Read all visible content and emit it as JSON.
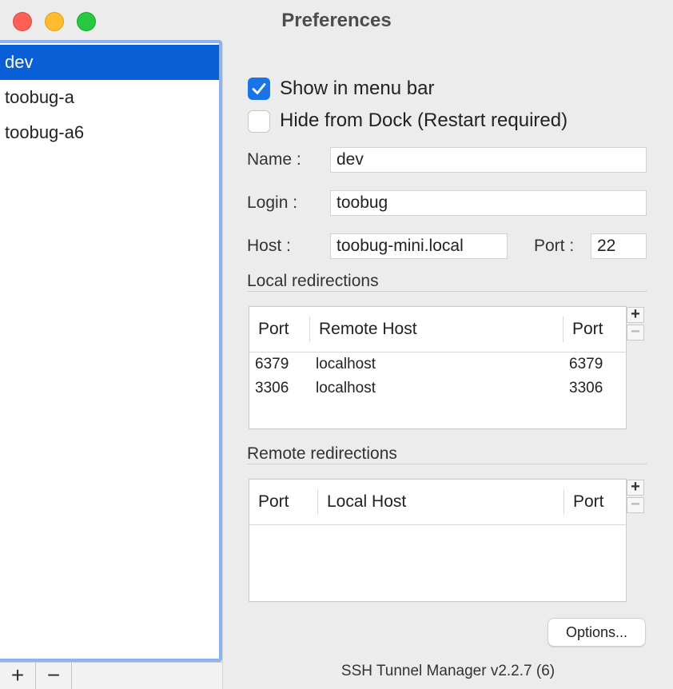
{
  "window": {
    "title": "Preferences"
  },
  "sidebar": {
    "items": [
      {
        "label": "dev",
        "selected": true
      },
      {
        "label": "toobug-a",
        "selected": false
      },
      {
        "label": "toobug-a6",
        "selected": false
      }
    ],
    "add_label": "+",
    "remove_label": "−"
  },
  "options": {
    "show_in_menu_bar": {
      "label": "Show in menu bar",
      "checked": true
    },
    "hide_from_dock": {
      "label": "Hide from Dock (Restart required)",
      "checked": false
    }
  },
  "form": {
    "name_label": "Name :",
    "name_value": "dev",
    "login_label": "Login :",
    "login_value": "toobug",
    "host_label": "Host :",
    "host_value": "toobug-mini.local",
    "port_label": "Port :",
    "port_value": "22"
  },
  "local_redirections": {
    "title": "Local redirections",
    "columns": [
      "Port",
      "Remote Host",
      "Port"
    ],
    "rows": [
      [
        "6379",
        "localhost",
        "6379"
      ],
      [
        "3306",
        "localhost",
        "3306"
      ]
    ]
  },
  "remote_redirections": {
    "title": "Remote redirections",
    "columns": [
      "Port",
      "Local Host",
      "Port"
    ],
    "rows": []
  },
  "table_controls": {
    "add": "+",
    "remove": "−"
  },
  "buttons": {
    "options": "Options..."
  },
  "footer": {
    "version": "SSH Tunnel Manager v2.2.7 (6)"
  },
  "colors": {
    "accent": "#0a5fd6",
    "checkbox": "#1a74e8",
    "focus_ring": "#8fb3ee"
  }
}
